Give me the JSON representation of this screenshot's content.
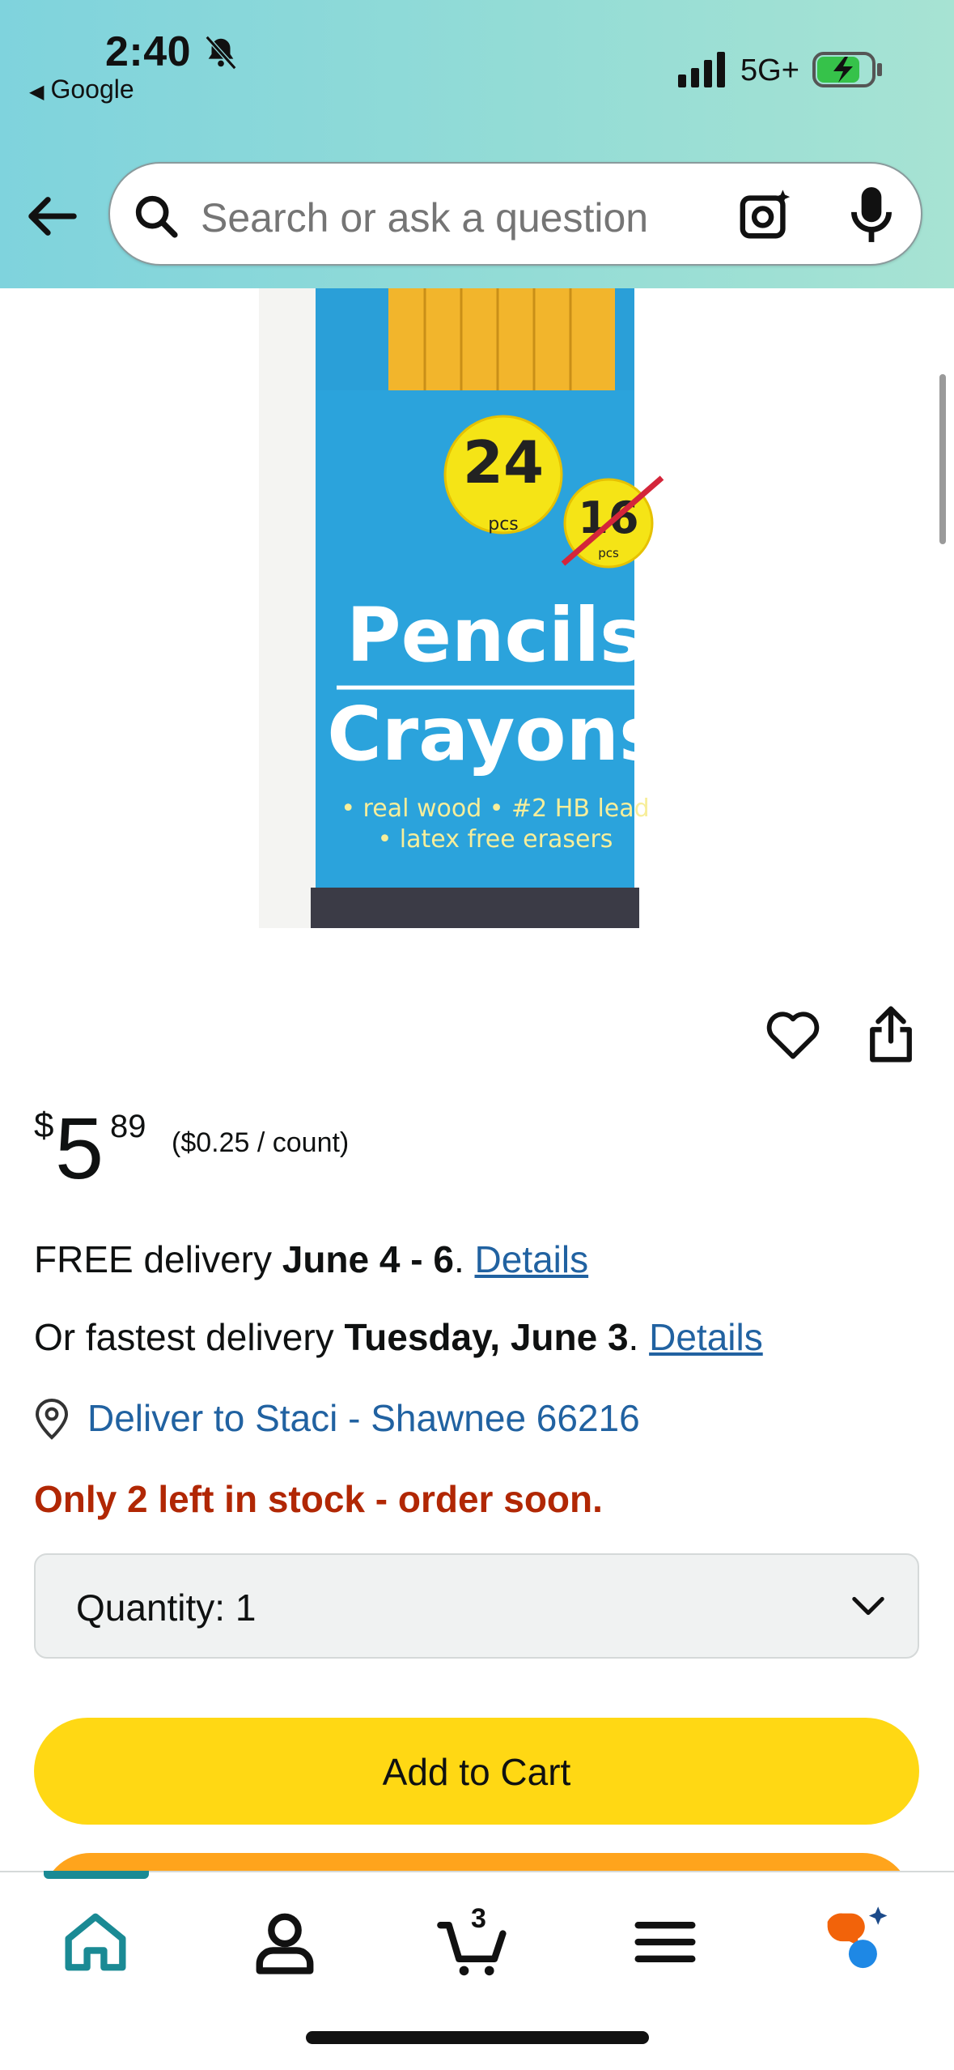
{
  "status_bar": {
    "time": "2:40",
    "back_app": "Google",
    "network": "5G+",
    "icons": [
      "bell-slash-icon",
      "cell-signal-icon",
      "battery-charging-icon"
    ]
  },
  "search": {
    "placeholder": "Search or ask a question",
    "icons": [
      "back-arrow-icon",
      "search-icon",
      "camera-lens-icon",
      "microphone-icon"
    ]
  },
  "product_image": {
    "count_badge": "24",
    "count_unit": "pcs",
    "old_count_badge": "16",
    "old_count_unit": "pcs",
    "title_line1": "Pencils",
    "title_line2": "Crayons",
    "bullets_line1": "• real wood  • #2 HB lead",
    "bullets_line2": "• latex free erasers"
  },
  "price": {
    "currency": "$",
    "whole": "5",
    "fraction": "89",
    "unit_price": "($0.25 / count)"
  },
  "delivery": {
    "free_prefix": "FREE delivery ",
    "free_dates": "June 4 - 6",
    "free_sep": ". ",
    "free_link": "Details",
    "fast_prefix": "Or fastest delivery ",
    "fast_date": "Tuesday, June 3",
    "fast_sep": ". ",
    "fast_link": "Details",
    "deliver_to": "Deliver to Staci - Shawnee 66216"
  },
  "stock_message": "Only 2 left in stock - order soon.",
  "quantity": {
    "label": "Quantity:",
    "value": "1"
  },
  "buttons": {
    "add_to_cart": "Add to Cart"
  },
  "bottom_nav": {
    "items": [
      "home-icon",
      "account-icon",
      "cart-icon",
      "menu-icon",
      "rufus-icon"
    ],
    "active": "home",
    "cart_count": "3"
  },
  "colors": {
    "header_gradient_start": "#7fd3dd",
    "header_gradient_end": "#a7e3d3",
    "link": "#2162a1",
    "stock_warning": "#b12704",
    "add_to_cart": "#ffd814",
    "buy_now": "#ffa41c",
    "nav_active": "#1a8a94"
  }
}
